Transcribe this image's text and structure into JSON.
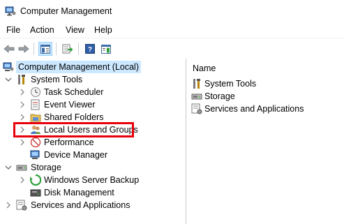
{
  "window": {
    "title": "Computer Management"
  },
  "menu": [
    {
      "label": "File"
    },
    {
      "label": "Action"
    },
    {
      "label": "View"
    },
    {
      "label": "Help"
    }
  ],
  "toolbar": {
    "buttons": [
      "back-arrow-icon",
      "forward-arrow-icon",
      "show-hide-tree-icon",
      "export-list-icon",
      "help-icon",
      "action-pane-icon"
    ]
  },
  "tree": {
    "root": "Computer Management (Local)",
    "system_tools": "System Tools",
    "task_scheduler": "Task Scheduler",
    "event_viewer": "Event Viewer",
    "shared_folders": "Shared Folders",
    "local_users": "Local Users and Groups",
    "performance": "Performance",
    "device_manager": "Device Manager",
    "storage": "Storage",
    "wsb": "Windows Server Backup",
    "disk_mgmt": "Disk Management",
    "services": "Services and Applications"
  },
  "right": {
    "column_header": "Name",
    "items": [
      "System Tools",
      "Storage",
      "Services and Applications"
    ]
  },
  "colors": {
    "highlight": "#e8000b",
    "selection": "#cce8ff"
  }
}
